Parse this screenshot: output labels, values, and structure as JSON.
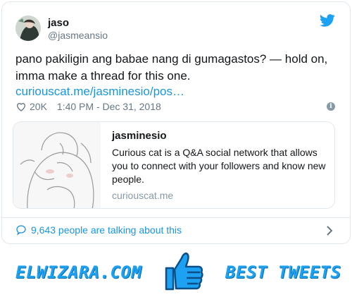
{
  "tweet": {
    "author_name": "jaso",
    "author_handle": "@jasmeansio",
    "text": "pano pakiligin ang babae nang di gumagastos? — hold on, imma make a thread for this one.",
    "link_text": "curiouscat.me/jasminesio/pos…",
    "likes": "20K",
    "timestamp": "1:40 PM - Dec 31, 2018",
    "info_glyph": "i"
  },
  "preview": {
    "title": "jasminesio",
    "description": "Curious cat is a Q&A social network that allows you to connect with your followers and know new people.",
    "domain": "curiouscat.me"
  },
  "footer": {
    "talking_text": "9,643 people are talking about this"
  },
  "banner": {
    "left_text": "ELWIZARA.COM",
    "right_text": "BEST TWEETS"
  },
  "colors": {
    "twitter_blue": "#1da1f2",
    "link_blue": "#1b95e0",
    "muted_gray": "#657786",
    "border": "#e1e8ed"
  },
  "icons": [
    "twitter-bird-icon",
    "heart-icon",
    "info-icon",
    "speech-bubble-icon",
    "chevron-right-icon",
    "thumbs-up-icon"
  ]
}
